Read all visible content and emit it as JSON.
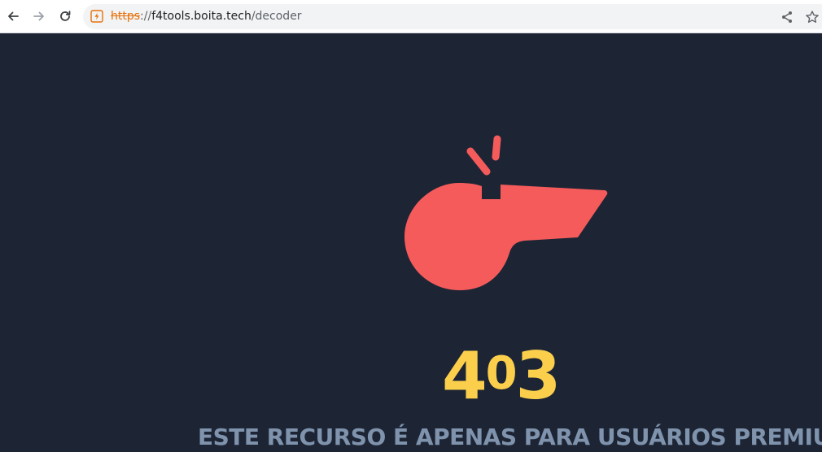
{
  "browser": {
    "url_scheme": "https",
    "url_separator": "://",
    "url_host": "f4tools.boita.tech",
    "url_path": "/decoder",
    "back_icon": "back-arrow-icon",
    "forward_icon": "forward-arrow-icon",
    "reload_icon": "reload-icon",
    "security_icon": "not-secure-warning-icon",
    "share_icon": "share-icon",
    "bookmark_icon": "star-icon"
  },
  "page": {
    "illustration": "whistle-icon",
    "error_code_first": "4",
    "error_code_middle": "0",
    "error_code_last": "3",
    "message": "ESTE RECURSO É APENAS PARA USUÁRIOS PREMIUM"
  },
  "colors": {
    "background": "#1d2535",
    "whistle": "#f65b5b",
    "error_code": "#fbcf4b",
    "message": "#7f93ad"
  }
}
